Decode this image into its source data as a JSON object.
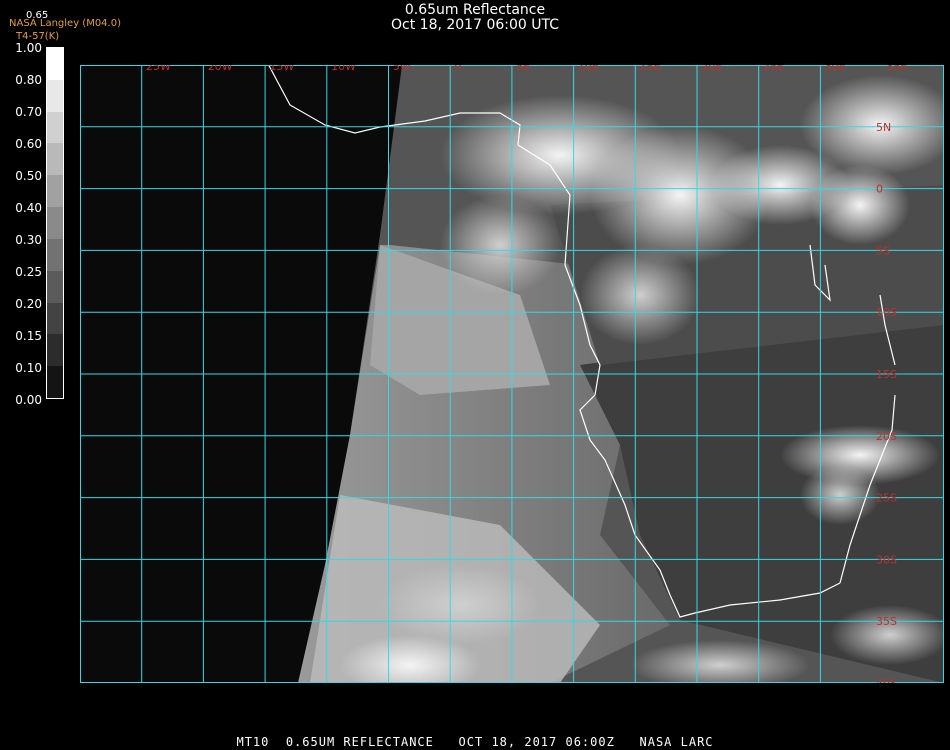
{
  "header": {
    "title": "0.65um Reflectance",
    "timestamp": "Oct 18, 2017 06:00 UTC",
    "org": "NASA Langley (M04.0)",
    "channel_tag": "0.65",
    "channel_sub": "T4-57(K)"
  },
  "legend": {
    "labels": [
      "1.00",
      "0.80",
      "0.70",
      "0.60",
      "0.50",
      "0.40",
      "0.30",
      "0.25",
      "0.20",
      "0.15",
      "0.10",
      "0.00"
    ]
  },
  "grid": {
    "lon_labels": [
      "25W",
      "20W",
      "15W",
      "10W",
      "5W",
      "0",
      "5E",
      "10E",
      "15E",
      "20E",
      "25E",
      "30E",
      "35E"
    ],
    "lat_labels": [
      "5N",
      "0",
      "5S",
      "10S",
      "15S",
      "20S",
      "25S",
      "30S",
      "35S",
      "40S"
    ]
  },
  "footer": {
    "text": "MT10  0.65UM REFLECTANCE   OCT 18, 2017 06:00Z   NASA LARC"
  },
  "colors": {
    "grid": "#37d7e6",
    "grid_label": "#c0302a",
    "coastline": "#ffffff",
    "header_orange": "#e0a040"
  }
}
